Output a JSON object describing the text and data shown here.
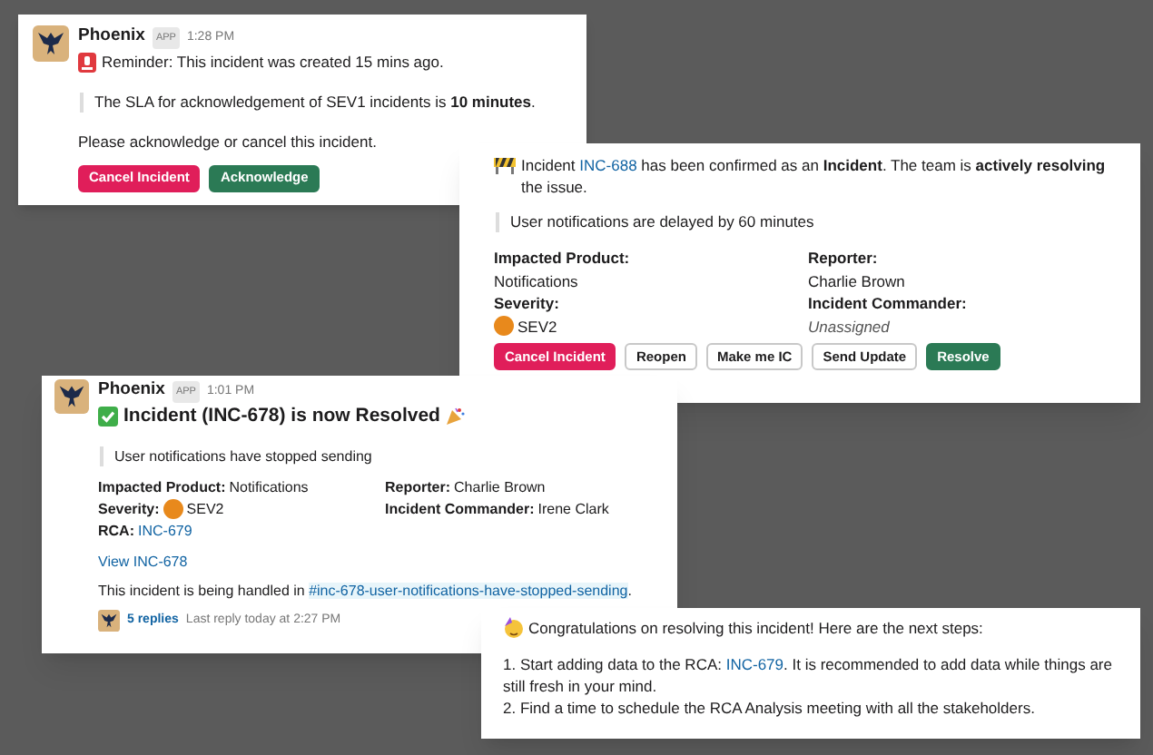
{
  "messages": [
    {
      "kind": "reminder",
      "sender": "Phoenix",
      "badge": "APP",
      "time": "1:28 PM",
      "text": "Reminder: This incident was created 15 mins ago.",
      "quote": "The SLA for acknowledgement of SEV1 incidents is **10 minutes**.",
      "prompt": "Please acknowledge or cancel this incident.",
      "buttons": [
        {
          "label": "Cancel Incident",
          "kind": "danger"
        },
        {
          "label": "Acknowledge",
          "kind": "primary"
        }
      ]
    },
    {
      "kind": "confirmed",
      "parts": [
        {
          "text": "Incident ",
          "kind": "text"
        },
        {
          "text": "INC-688",
          "kind": "link"
        },
        {
          "text": " has been confirmed as an **Incident**. The team is **actively resolving** the issue.",
          "kind": "text"
        }
      ],
      "quote": "User notifications are delayed by 60 minutes",
      "fields": [
        {
          "label": "Impacted Product:",
          "value": "Notifications",
          "unset": false
        },
        {
          "label": "Reporter:",
          "value": "Charlie Brown",
          "unset": false
        },
        {
          "label": "Severity:",
          "value": "SEV2",
          "severity_dot": true,
          "unset": false
        },
        {
          "label": "Incident Commander:",
          "value": "Unassigned",
          "unset": true
        }
      ],
      "buttons": [
        {
          "label": "Cancel Incident",
          "kind": "danger"
        },
        {
          "label": "Reopen",
          "kind": "default"
        },
        {
          "label": "Make me IC",
          "kind": "default"
        },
        {
          "label": "Send Update",
          "kind": "default"
        },
        {
          "label": "Resolve",
          "kind": "primary"
        }
      ]
    },
    {
      "kind": "resolved",
      "sender": "Phoenix",
      "badge": "APP",
      "time": "1:01 PM",
      "title": "Incident (INC-678) is now Resolved",
      "quote": "User notifications have stopped sending",
      "fields": [
        {
          "label": "Impacted Product:",
          "value": "Notifications",
          "link": false
        },
        {
          "label": "Reporter:",
          "value": "Charlie Brown",
          "link": false
        },
        {
          "label": "Severity:",
          "value": "SEV2",
          "severity_dot": true,
          "link": false
        },
        {
          "label": "Incident Commander:",
          "value": "Irene Clark",
          "link": false
        },
        {
          "label": "RCA:",
          "value": "INC-679",
          "link": true
        }
      ],
      "view_link": "View INC-678",
      "channel_parts": [
        {
          "text": "This incident is being handled in ",
          "kind": "text"
        },
        {
          "text": "#inc-678-user-notifications-have-stopped-sending",
          "kind": "channel"
        },
        {
          "text": ".",
          "kind": "text"
        }
      ],
      "replies": "5 replies",
      "last_reply": "Last reply today at 2:27 PM"
    },
    {
      "kind": "steps",
      "intro": "Congratulations on resolving this incident! Here are the next steps:",
      "steps": [
        [
          {
            "text": "1. Start adding data to the RCA: ",
            "kind": "text"
          },
          {
            "text": "INC-679",
            "kind": "link"
          },
          {
            "text": ". It is recommended to add data while things are still fresh in your mind.",
            "kind": "text"
          }
        ],
        [
          {
            "text": "2. Find a time to schedule the RCA Analysis meeting with all the stakeholders.",
            "kind": "text"
          }
        ]
      ]
    }
  ]
}
